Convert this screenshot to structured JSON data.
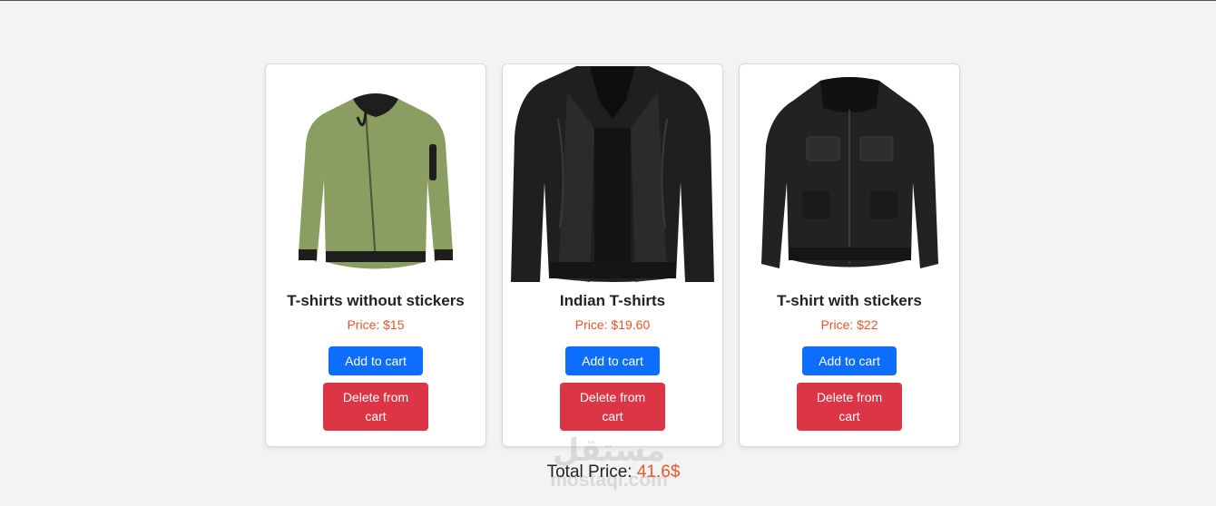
{
  "products": [
    {
      "title": "T-shirts without stickers",
      "price": "Price: $15",
      "add_label": "Add to cart",
      "delete_label": "Delete from cart",
      "image": "green-bomber-jacket"
    },
    {
      "title": "Indian T-shirts",
      "price": "Price: $19.60",
      "add_label": "Add to cart",
      "delete_label": "Delete from cart",
      "image": "black-leather-jacket"
    },
    {
      "title": "T-shirt with stickers",
      "price": "Price: $22",
      "add_label": "Add to cart",
      "delete_label": "Delete from cart",
      "image": "black-field-jacket"
    }
  ],
  "total": {
    "label": "Total Price:",
    "amount": "41.6$"
  },
  "watermark": {
    "arabic": "مستقل",
    "latin": "mostaqi.com"
  },
  "colors": {
    "background": "#f3f3f3",
    "add_button": "#0d6efd",
    "delete_button": "#dc3545",
    "price_text": "#e4572e"
  }
}
